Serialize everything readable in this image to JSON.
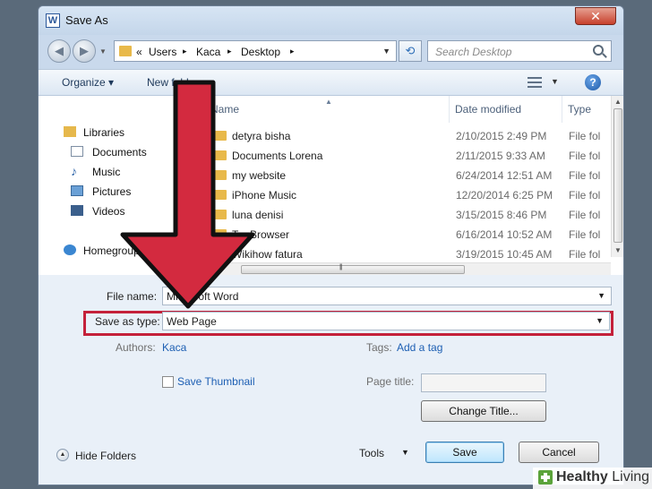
{
  "window": {
    "title": "Save As",
    "app_icon_letter": "W",
    "close_glyph": "✕"
  },
  "navigation": {
    "back_glyph": "◀",
    "forward_glyph": "▶",
    "address": {
      "prefix": "«",
      "crumbs": [
        "Users",
        "Kaca",
        "Desktop"
      ],
      "separator": "▸"
    },
    "search_placeholder": "Search Desktop"
  },
  "toolbar": {
    "organize_label": "Organize ▾",
    "new_folder_label": "New folder"
  },
  "nav_pane": {
    "items": [
      {
        "label": "Libraries",
        "icon": "libraries-icon"
      },
      {
        "label": "Documents",
        "icon": "documents-icon"
      },
      {
        "label": "Music",
        "icon": "music-icon"
      },
      {
        "label": "Pictures",
        "icon": "pictures-icon"
      },
      {
        "label": "Videos",
        "icon": "videos-icon"
      },
      {
        "label": "Homegroup",
        "icon": "homegroup-icon"
      }
    ]
  },
  "file_list": {
    "columns": [
      "Name",
      "Date modified",
      "Type"
    ],
    "rows": [
      {
        "name": "detyra bisha",
        "date": "2/10/2015 2:49 PM",
        "type": "File fol"
      },
      {
        "name": "Documents Lorena",
        "date": "2/11/2015 9:33 AM",
        "type": "File fol"
      },
      {
        "name": "my website",
        "date": "6/24/2014 12:51 AM",
        "type": "File fol"
      },
      {
        "name": "iPhone Music",
        "date": "12/20/2014 6:25 PM",
        "type": "File fol"
      },
      {
        "name": "luna denisi",
        "date": "3/15/2015 8:46 PM",
        "type": "File fol"
      },
      {
        "name": "Tor Browser",
        "date": "6/16/2014 10:52 AM",
        "type": "File fol"
      },
      {
        "name": "Wikihow fatura",
        "date": "3/19/2015 10:45 AM",
        "type": "File fol"
      }
    ]
  },
  "form": {
    "file_name_label": "File name:",
    "file_name_value": "Microsoft Word",
    "save_as_type_label": "Save as type:",
    "save_as_type_value": "Web Page",
    "authors_label": "Authors:",
    "authors_value": "Kaca",
    "tags_label": "Tags:",
    "tags_value": "Add a tag",
    "thumbnail_label": "Save Thumbnail",
    "page_title_label": "Page title:",
    "page_title_value": "",
    "change_title_label": "Change Title..."
  },
  "footer": {
    "hide_folders_label": "Hide Folders",
    "tools_label": "Tools",
    "save_label": "Save",
    "cancel_label": "Cancel"
  },
  "watermark": {
    "brand_bold": "Healthy",
    "brand_rest": " Living"
  },
  "colors": {
    "highlight_red": "#c4213a",
    "arrow_red": "#d32a3f",
    "link_blue": "#1d5fb3",
    "folder": "#e8b94a"
  }
}
